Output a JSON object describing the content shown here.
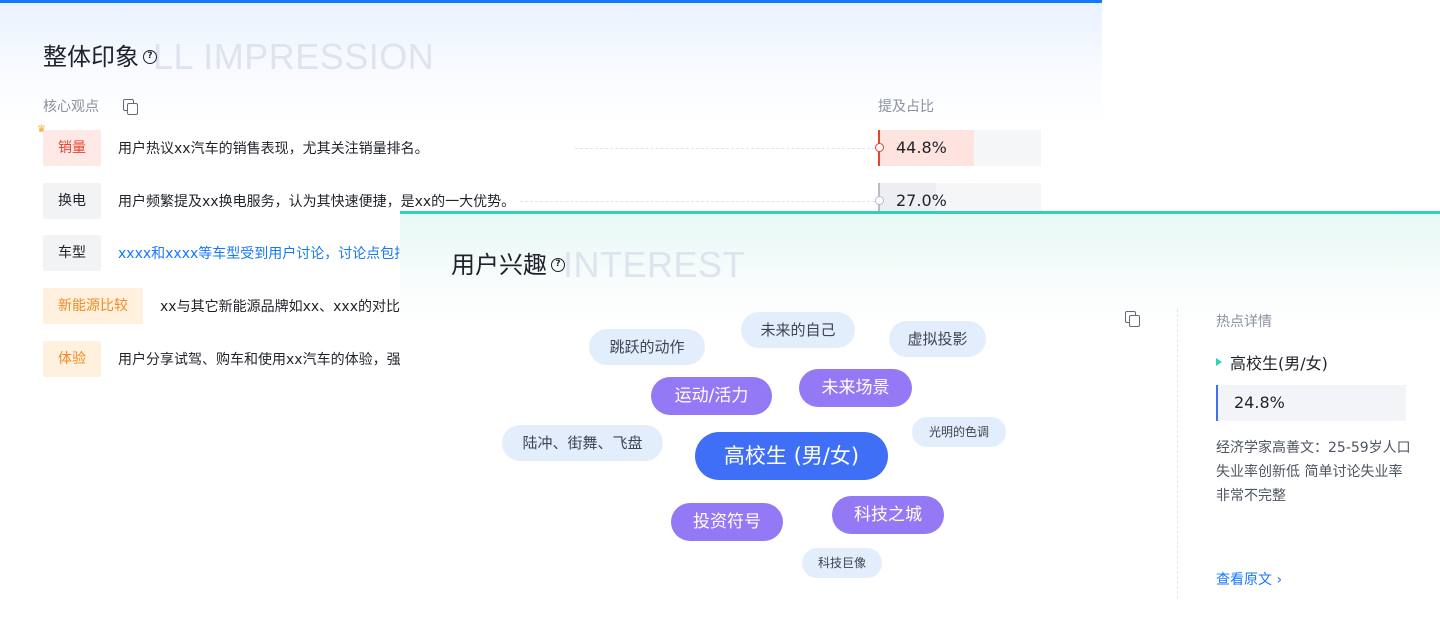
{
  "overall": {
    "title": "整体印象",
    "ghost_title": "LL IMPRESSION",
    "help_glyph": "?",
    "col_core": "核心观点",
    "col_share": "提及占比",
    "rows": [
      {
        "tag": "销量",
        "style": "red",
        "text": "用户热议xx汽车的销售表现，尤其关注销量排名。",
        "share_label": "44.8%",
        "share": 44.8,
        "link": false
      },
      {
        "tag": "换电",
        "style": "gray",
        "text": "用户频繁提及xx换电服务，认为其快速便捷，是xx的一大优势。",
        "share_label": "27.0%",
        "share": 27.0,
        "link": false
      },
      {
        "tag": "车型",
        "style": "gray",
        "text": "xxxx和xxxx等车型受到用户讨论，讨论点包括",
        "link": true
      },
      {
        "tag": "新能源比较",
        "style": "orange",
        "text": "xx与其它新能源品牌如xx、xxx的对比",
        "link": false
      },
      {
        "tag": "体验",
        "style": "orange",
        "text": "用户分享试驾、购车和使用xx汽车的体验，强",
        "link": false
      }
    ],
    "colors": {
      "accent": "#1677ff",
      "red": "#e8432e",
      "orange": "#f08a24"
    }
  },
  "interest": {
    "title": "用户兴趣",
    "ghost_title": "INTEREST",
    "help_glyph": "?",
    "bubbles": [
      {
        "label": "跳跃的动作",
        "style": "light"
      },
      {
        "label": "未来的自己",
        "style": "light"
      },
      {
        "label": "虚拟投影",
        "style": "light"
      },
      {
        "label": "运动/活力",
        "style": "purple"
      },
      {
        "label": "未来场景",
        "style": "purple"
      },
      {
        "label": "陆冲、街舞、飞盘",
        "style": "light"
      },
      {
        "label": "高校生 (男/女)",
        "style": "blue"
      },
      {
        "label": "光明的色调",
        "style": "light"
      },
      {
        "label": "投资符号",
        "style": "purple"
      },
      {
        "label": "科技之城",
        "style": "purple"
      },
      {
        "label": "科技巨像",
        "style": "light"
      }
    ],
    "detail": {
      "heading": "热点详情",
      "selected": "高校生(男/女)",
      "share_label": "24.8%",
      "share": 24.8,
      "description": "经济学家高善文：25-59岁人口失业率创新低 简单讨论失业率非常不完整",
      "view_link": "查看原文 ›"
    },
    "colors": {
      "accent": "#2fd2b4",
      "purple": "#9379f5",
      "blue": "#3f6ff7"
    }
  }
}
